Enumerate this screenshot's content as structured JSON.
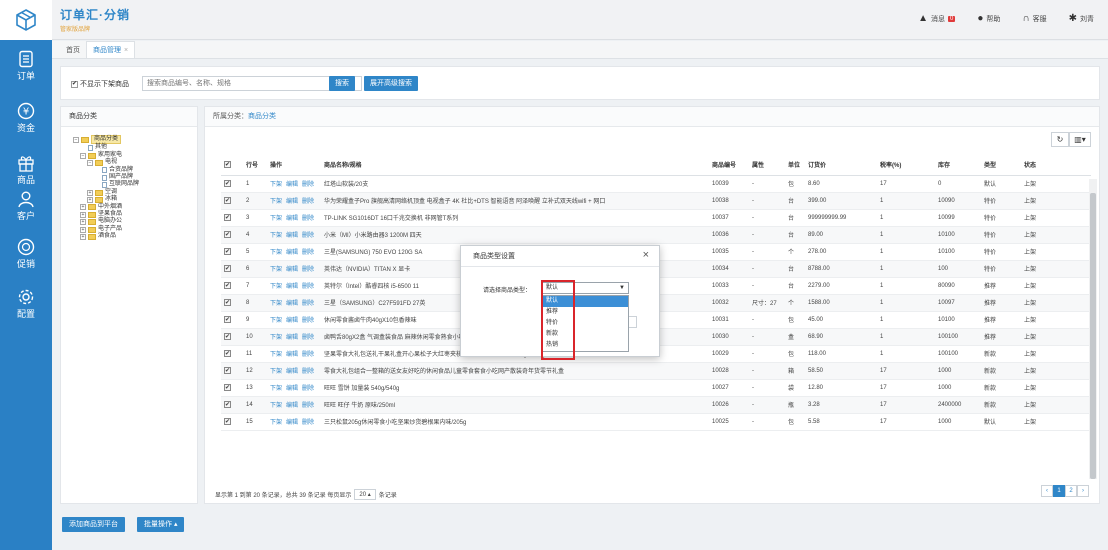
{
  "header": {
    "brand_title": "订单汇·分销",
    "brand_sub": "管家版品牌",
    "messages_label": "消息",
    "messages_count": "0",
    "help_label": "帮助",
    "service_label": "客服",
    "user_label": "刘青"
  },
  "sidebar": {
    "items": [
      {
        "label": "订单",
        "icon": "order-icon"
      },
      {
        "label": "资金",
        "icon": "yen-icon"
      },
      {
        "label": "商品",
        "icon": "gift-icon"
      },
      {
        "label": "客户",
        "icon": "user-icon"
      },
      {
        "label": "促销",
        "icon": "tag-icon"
      },
      {
        "label": "配置",
        "icon": "gear-icon"
      }
    ]
  },
  "tabs": [
    {
      "label": "首页"
    },
    {
      "label": "商品管理"
    }
  ],
  "search": {
    "hide_offline_label": "不显示下架商品",
    "placeholder": "搜索商品编号、名称、规格",
    "search_button": "搜索",
    "advanced_button": "展开高级搜索"
  },
  "category": {
    "title": "商品分类",
    "tree": [
      {
        "label": "商品分类",
        "level": 0,
        "type": "folder",
        "toggle": "⊟",
        "selected": true
      },
      {
        "label": "其他",
        "level": 1,
        "type": "doc",
        "toggle": ""
      },
      {
        "label": "家用家电",
        "level": 1,
        "type": "folder",
        "toggle": "⊟"
      },
      {
        "label": "电视",
        "level": 2,
        "type": "folder",
        "toggle": "⊟"
      },
      {
        "label": "合资品牌",
        "level": 3,
        "type": "doc",
        "toggle": ""
      },
      {
        "label": "国产品牌",
        "level": 3,
        "type": "doc",
        "toggle": ""
      },
      {
        "label": "互联网品牌",
        "level": 3,
        "type": "doc",
        "toggle": ""
      },
      {
        "label": "空调",
        "level": 2,
        "type": "folder",
        "toggle": "⊞"
      },
      {
        "label": "冰箱",
        "level": 2,
        "type": "folder",
        "toggle": "⊞"
      },
      {
        "label": "中外烟酒",
        "level": 1,
        "type": "folder",
        "toggle": "⊞"
      },
      {
        "label": "坚果食品",
        "level": 1,
        "type": "folder",
        "toggle": "⊞"
      },
      {
        "label": "电脑办公",
        "level": 1,
        "type": "folder",
        "toggle": "⊞"
      },
      {
        "label": "电子产品",
        "level": 1,
        "type": "folder",
        "toggle": "⊞"
      },
      {
        "label": "酒食品",
        "level": 1,
        "type": "folder",
        "toggle": "⊞"
      }
    ]
  },
  "main": {
    "crumb_prefix": "所属分类：",
    "crumb_link": "商品分类",
    "refresh_icon": "refresh-icon",
    "columns_icon": "columns-icon",
    "columns": [
      "",
      "行号",
      "操作",
      "商品名称/规格",
      "商品编号",
      "属性",
      "单位",
      "订货价",
      "税率(%)",
      "库存",
      "类型",
      "状态"
    ],
    "actions": [
      "下架",
      "编辑",
      "删除"
    ],
    "rows": [
      {
        "no": "1",
        "name": "红塔山软装/20支",
        "code": "10039",
        "attr": "-",
        "unit": "包",
        "price": "8.60",
        "tax": "17",
        "stock": "0",
        "type": "默认",
        "status": "上架"
      },
      {
        "no": "2",
        "name": "华为荣耀盒子Pro 旗舰高清网络机顶盒 电视盒子 4K 杜比+DTS 智能语音 阿泽唤醒 立补式双天线wifi + 网口",
        "code": "10038",
        "attr": "-",
        "unit": "台",
        "price": "399.00",
        "tax": "1",
        "stock": "10090",
        "type": "特价",
        "status": "上架"
      },
      {
        "no": "3",
        "name": "TP-LINK SG1016DT 16口千兆交换机 非网管T系列",
        "code": "10037",
        "attr": "-",
        "unit": "台",
        "price": "999999999.99",
        "tax": "1",
        "stock": "10099",
        "type": "特价",
        "status": "上架"
      },
      {
        "no": "4",
        "name": "小米（MI）小米路由器3 1200M 四天",
        "code": "10036",
        "attr": "-",
        "unit": "台",
        "price": "89.00",
        "tax": "1",
        "stock": "10100",
        "type": "特价",
        "status": "上架"
      },
      {
        "no": "5",
        "name": "三星(SAMSUNG) 750 EVO 120G SA",
        "code": "10035",
        "attr": "-",
        "unit": "个",
        "price": "278.00",
        "tax": "1",
        "stock": "10100",
        "type": "特价",
        "status": "上架"
      },
      {
        "no": "6",
        "name": "英伟达（NVIDIA）TITAN X 显卡",
        "code": "10034",
        "attr": "-",
        "unit": "台",
        "price": "8788.00",
        "tax": "1",
        "stock": "100",
        "type": "特价",
        "status": "上架"
      },
      {
        "no": "7",
        "name": "英特尔（Intel）酷睿四核 i5-6500 11",
        "code": "10033",
        "attr": "-",
        "unit": "台",
        "price": "2279.00",
        "tax": "1",
        "stock": "80090",
        "type": "推荐",
        "status": "上架"
      },
      {
        "no": "8",
        "name": "三星（SAMSUNG）C27F591FD 27英",
        "code": "10032",
        "attr": "尺寸：27",
        "unit": "个",
        "price": "1588.00",
        "tax": "1",
        "stock": "10097",
        "type": "推荐",
        "status": "上架"
      },
      {
        "no": "9",
        "name": "休闲零食酱卤牛肉40gX10包香辣味",
        "code": "10031",
        "attr": "-",
        "unit": "包",
        "price": "45.00",
        "tax": "1",
        "stock": "10100",
        "type": "推荐",
        "status": "上架"
      },
      {
        "no": "10",
        "name": "卤鸭舌80gX2盒 气调盒装食品 麻辣休闲零食熟食小吃/80g",
        "code": "10030",
        "attr": "-",
        "unit": "盒",
        "price": "68.90",
        "tax": "1",
        "stock": "100100",
        "type": "推荐",
        "status": "上架"
      },
      {
        "no": "11",
        "name": "坚果零食大礼包送礼干果礼盒开心果松子大红枣夹核桃一整箱休闲零食1610g/1610g",
        "code": "10029",
        "attr": "-",
        "unit": "包",
        "price": "118.00",
        "tax": "1",
        "stock": "100100",
        "type": "新款",
        "status": "上架"
      },
      {
        "no": "12",
        "name": "零食大礼包组合一整箱的送女友好吃的休闲食品儿童零食套食小吃网产散装奇年货零节礼盒",
        "code": "10028",
        "attr": "-",
        "unit": "箱",
        "price": "58.50",
        "tax": "17",
        "stock": "1000",
        "type": "新款",
        "status": "上架"
      },
      {
        "no": "13",
        "name": "旺旺 雪饼 加量装 540g/540g",
        "code": "10027",
        "attr": "-",
        "unit": "袋",
        "price": "12.80",
        "tax": "17",
        "stock": "1000",
        "type": "新款",
        "status": "上架"
      },
      {
        "no": "14",
        "name": "旺旺 旺仔 牛奶 原味/250ml",
        "code": "10026",
        "attr": "-",
        "unit": "瓶",
        "price": "3.28",
        "tax": "17",
        "stock": "2400000",
        "type": "新款",
        "status": "上架"
      },
      {
        "no": "15",
        "name": "三只松鼠205g休闲零食小吃坚果炒货碧根果内味/205g",
        "code": "10025",
        "attr": "-",
        "unit": "包",
        "price": "5.58",
        "tax": "17",
        "stock": "1000",
        "type": "默认",
        "status": "上架"
      }
    ],
    "footer_text_1": "显示第 1 到第 20 条记录，总共 39 条记录 每页显示",
    "page_size": "20",
    "footer_text_2": "条记录",
    "pages": [
      "‹",
      "1",
      "2",
      "›"
    ],
    "active_page": "1"
  },
  "bottom": {
    "add_button": "添加商品到平台",
    "batch_button": "批量操作"
  },
  "modal": {
    "title": "商品类型设置",
    "close": "×",
    "label": "请选择商品类型：",
    "selected": "默认",
    "options": [
      "默认",
      "推荐",
      "特价",
      "新款",
      "热销"
    ]
  },
  "colors": {
    "brand_blue": "#2a80c5",
    "link_blue": "#2f86c8",
    "highlight_red": "#d9252b"
  }
}
